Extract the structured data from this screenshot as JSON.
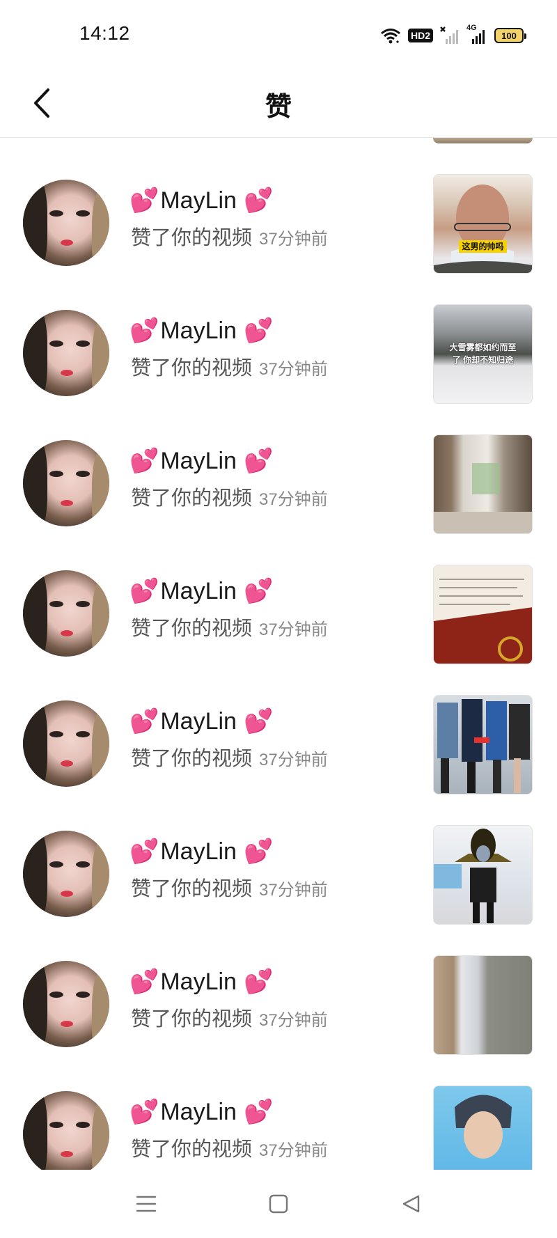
{
  "status_bar": {
    "time": "14:12",
    "hd_label": "HD2",
    "network_label": "4G",
    "battery": "100",
    "icons": [
      "wifi-icon",
      "hd-icon",
      "no-signal-icon",
      "signal-4g-icon",
      "battery-icon"
    ]
  },
  "header": {
    "title": "赞",
    "back_icon": "chevron-left-icon"
  },
  "notifications": [
    {
      "username": "MayLin",
      "heart_left": "💕",
      "heart_right": "💕",
      "action": "赞了你的视频",
      "time": "37分钟前",
      "thumb_caption": "这男的帅吗",
      "thumb_theme": "man-face"
    },
    {
      "username": "MayLin",
      "heart_left": "💕",
      "heart_right": "💕",
      "action": "赞了你的视频",
      "time": "37分钟前",
      "thumb_caption": "大雪雾都如约而至了 你却不知归途",
      "thumb_theme": "snow-park"
    },
    {
      "username": "MayLin",
      "heart_left": "💕",
      "heart_right": "💕",
      "action": "赞了你的视频",
      "time": "37分钟前",
      "thumb_caption": "",
      "thumb_theme": "room-interior"
    },
    {
      "username": "MayLin",
      "heart_left": "💕",
      "heart_right": "💕",
      "action": "赞了你的视频",
      "time": "37分钟前",
      "thumb_caption": "",
      "thumb_theme": "certificate"
    },
    {
      "username": "MayLin",
      "heart_left": "💕",
      "heart_right": "💕",
      "action": "赞了你的视频",
      "time": "37分钟前",
      "thumb_caption": "",
      "thumb_theme": "street-group"
    },
    {
      "username": "MayLin",
      "heart_left": "💕",
      "heart_right": "💕",
      "action": "赞了你的视频",
      "time": "37分钟前",
      "thumb_caption": "",
      "thumb_theme": "costume-figure"
    },
    {
      "username": "MayLin",
      "heart_left": "💕",
      "heart_right": "💕",
      "action": "赞了你的视频",
      "time": "37分钟前",
      "thumb_caption": "",
      "thumb_theme": "doorway"
    },
    {
      "username": "MayLin",
      "heart_left": "💕",
      "heart_right": "💕",
      "action": "赞了你的视频",
      "time": "37分钟前",
      "thumb_caption": "",
      "thumb_theme": "cartoon-face"
    }
  ],
  "nav_bar": {
    "icons": [
      "menu-icon",
      "home-square-icon",
      "back-triangle-icon"
    ]
  }
}
